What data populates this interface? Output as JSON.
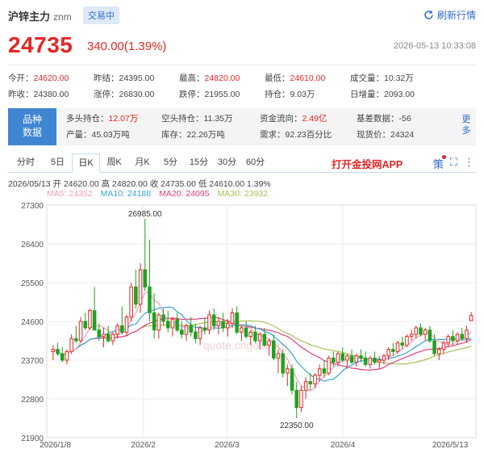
{
  "header": {
    "title": "沪锌主力",
    "code": "znm",
    "badge": "交易中",
    "refresh": "刷新行情"
  },
  "quote": {
    "price": "24735",
    "change": "340.00(1.39%)",
    "time": "2026-05-13 10:33:08"
  },
  "stats": [
    [
      {
        "label": "今开：",
        "value": "24620.00",
        "red": true
      },
      {
        "label": "昨结：",
        "value": "24395.00",
        "red": false
      },
      {
        "label": "最高：",
        "value": "24820.00",
        "red": true
      },
      {
        "label": "最低：",
        "value": "24610.00",
        "red": true
      },
      {
        "label": "成交量：",
        "value": "10.32万",
        "red": false
      }
    ],
    [
      {
        "label": "昨收：",
        "value": "24380.00",
        "red": false
      },
      {
        "label": "涨停：",
        "value": "26830.00",
        "red": false
      },
      {
        "label": "跌停：",
        "value": "21955.00",
        "red": false
      },
      {
        "label": "持仓：",
        "value": "9.03万",
        "red": false
      },
      {
        "label": "日增量：",
        "value": "2093.00",
        "red": false
      }
    ]
  ],
  "variety": {
    "label_line1": "品种",
    "label_line2": "数据",
    "more_line1": "更",
    "more_line2": "多",
    "rows": [
      [
        {
          "label": "多头持仓：",
          "value": "12.07万",
          "red": true
        },
        {
          "label": "空头持仓：",
          "value": "11.35万",
          "red": false
        },
        {
          "label": "资金流向：",
          "value": "2.49亿",
          "red": true
        },
        {
          "label": "基差数据：",
          "value": "-56",
          "red": false
        }
      ],
      [
        {
          "label": "产量：",
          "value": "45.03万吨",
          "red": false
        },
        {
          "label": "库存：",
          "value": "22.26万吨",
          "red": false
        },
        {
          "label": "需求：",
          "value": "92.23百分比",
          "red": false
        },
        {
          "label": "现货价：",
          "value": "24324",
          "red": false
        }
      ]
    ]
  },
  "tabs": [
    "分时",
    "5日",
    "日K",
    "周K",
    "月K",
    "5分",
    "15分",
    "30分",
    "60分"
  ],
  "active_tab": 2,
  "app_link": "打开金投网APP",
  "tool_labels": {
    "strategy": "策"
  },
  "kinfo": {
    "line": "2026/05/13  开 24620.00  高 24820.00  收 24735.00  低 24610.00  1.39%",
    "ma": [
      {
        "name": "MA5: 24352",
        "color": "#f2a1c0"
      },
      {
        "name": "MA10: 24188",
        "color": "#3aa3d6"
      },
      {
        "name": "MA20: 24095",
        "color": "#e0417f"
      },
      {
        "name": "MA30: 23932",
        "color": "#a9c05a"
      }
    ]
  },
  "chart_data": {
    "type": "candlestick",
    "y_ticks": [
      "27300",
      "26400",
      "25500",
      "24600",
      "23700",
      "22800",
      "21900"
    ],
    "y_range": [
      21900,
      27300
    ],
    "x_labels": [
      "2026/1/8",
      "2026/2",
      "2026/3",
      "2026/4",
      "2026/5/13"
    ],
    "annotations": {
      "high": "26985.00",
      "low": "22350.00"
    },
    "watermark": "quote.cngold.org",
    "colors": {
      "up": "#e52626",
      "down": "#1ea31e",
      "ma5": "#f2a1c0",
      "ma10": "#3aa3d6",
      "ma20": "#e0417f",
      "ma30": "#a9c05a"
    },
    "candles": [
      [
        23900,
        24050,
        23700,
        23950
      ],
      [
        23950,
        24100,
        23800,
        23850
      ],
      [
        23850,
        24000,
        23650,
        23700
      ],
      [
        23700,
        23950,
        23600,
        23900
      ],
      [
        23900,
        24300,
        23850,
        24200
      ],
      [
        24200,
        24500,
        24100,
        24150
      ],
      [
        24150,
        24700,
        24100,
        24600
      ],
      [
        24600,
        24800,
        24400,
        24450
      ],
      [
        24450,
        24900,
        24400,
        24850
      ],
      [
        24850,
        25400,
        24500,
        24400
      ],
      [
        24400,
        24550,
        24150,
        24250
      ],
      [
        24250,
        24450,
        24000,
        24300
      ],
      [
        24300,
        24500,
        24100,
        24150
      ],
      [
        24150,
        24350,
        24050,
        24300
      ],
      [
        24300,
        24550,
        24200,
        24500
      ],
      [
        24500,
        24950,
        24300,
        24350
      ],
      [
        24350,
        24750,
        24250,
        24700
      ],
      [
        24700,
        25500,
        24600,
        25400
      ],
      [
        25400,
        25800,
        24900,
        25000
      ],
      [
        25000,
        25950,
        24800,
        25800
      ],
      [
        25800,
        26985,
        25300,
        25400
      ],
      [
        25400,
        26500,
        24600,
        24800
      ],
      [
        24800,
        25250,
        24200,
        24400
      ],
      [
        24400,
        24800,
        24200,
        24750
      ],
      [
        24750,
        24900,
        24500,
        24600
      ],
      [
        24600,
        24850,
        24350,
        24450
      ],
      [
        24450,
        24700,
        24250,
        24650
      ],
      [
        24650,
        24800,
        24350,
        24400
      ],
      [
        24400,
        24600,
        24200,
        24300
      ],
      [
        24300,
        24550,
        24150,
        24500
      ],
      [
        24500,
        24700,
        24250,
        24350
      ],
      [
        24350,
        24550,
        24100,
        24200
      ],
      [
        24200,
        24500,
        24050,
        24450
      ],
      [
        24450,
        24700,
        24300,
        24400
      ],
      [
        24400,
        24850,
        24300,
        24750
      ],
      [
        24750,
        24900,
        24400,
        24500
      ],
      [
        24500,
        24700,
        24300,
        24600
      ],
      [
        24600,
        24800,
        24350,
        24450
      ],
      [
        24450,
        24650,
        24250,
        24550
      ],
      [
        24550,
        24900,
        24450,
        24800
      ],
      [
        24800,
        24950,
        24300,
        24350
      ],
      [
        24350,
        24500,
        24150,
        24450
      ],
      [
        24450,
        24600,
        24200,
        24250
      ],
      [
        24250,
        24400,
        24050,
        24350
      ],
      [
        24350,
        24500,
        24100,
        24150
      ],
      [
        24150,
        24350,
        23950,
        24300
      ],
      [
        24300,
        24450,
        24000,
        24050
      ],
      [
        24050,
        24200,
        23800,
        24150
      ],
      [
        24150,
        24300,
        23700,
        23750
      ],
      [
        23750,
        23950,
        23400,
        23850
      ],
      [
        23850,
        23950,
        23300,
        23400
      ],
      [
        23400,
        23600,
        23100,
        23500
      ],
      [
        23500,
        23600,
        22900,
        23000
      ],
      [
        23000,
        23200,
        22350,
        22600
      ],
      [
        22600,
        23100,
        22500,
        23000
      ],
      [
        23000,
        23300,
        22800,
        23200
      ],
      [
        23200,
        23400,
        23000,
        23150
      ],
      [
        23150,
        23400,
        23050,
        23350
      ],
      [
        23350,
        23600,
        23200,
        23500
      ],
      [
        23500,
        23700,
        23300,
        23400
      ],
      [
        23400,
        23800,
        23350,
        23750
      ],
      [
        23750,
        23900,
        23550,
        23650
      ],
      [
        23650,
        23900,
        23550,
        23850
      ],
      [
        23850,
        24000,
        23650,
        23700
      ],
      [
        23700,
        23850,
        23500,
        23800
      ],
      [
        23800,
        23950,
        23600,
        23650
      ],
      [
        23650,
        23850,
        23550,
        23800
      ],
      [
        23800,
        23950,
        23650,
        23750
      ],
      [
        23750,
        23900,
        23550,
        23600
      ],
      [
        23600,
        23800,
        23500,
        23750
      ],
      [
        23750,
        23900,
        23600,
        23650
      ],
      [
        23650,
        23800,
        23500,
        23700
      ],
      [
        23700,
        23850,
        23600,
        23800
      ],
      [
        23800,
        24000,
        23700,
        23950
      ],
      [
        23950,
        24100,
        23800,
        23900
      ],
      [
        23900,
        24150,
        23850,
        24100
      ],
      [
        24100,
        24250,
        23950,
        24050
      ],
      [
        24050,
        24300,
        24000,
        24250
      ],
      [
        24250,
        24400,
        24150,
        24300
      ],
      [
        24300,
        24500,
        24200,
        24450
      ],
      [
        24450,
        24550,
        24250,
        24300
      ],
      [
        24300,
        24450,
        24150,
        24400
      ],
      [
        24400,
        24500,
        24100,
        24150
      ],
      [
        24150,
        24300,
        23800,
        23850
      ],
      [
        23850,
        24000,
        23700,
        23950
      ],
      [
        23950,
        24150,
        23850,
        24100
      ],
      [
        24100,
        24300,
        24000,
        24250
      ],
      [
        24250,
        24400,
        24050,
        24150
      ],
      [
        24150,
        24350,
        24050,
        24300
      ],
      [
        24300,
        24450,
        24150,
        24200
      ],
      [
        24200,
        24500,
        24100,
        24395
      ],
      [
        24620,
        24820,
        24610,
        24735
      ]
    ]
  }
}
